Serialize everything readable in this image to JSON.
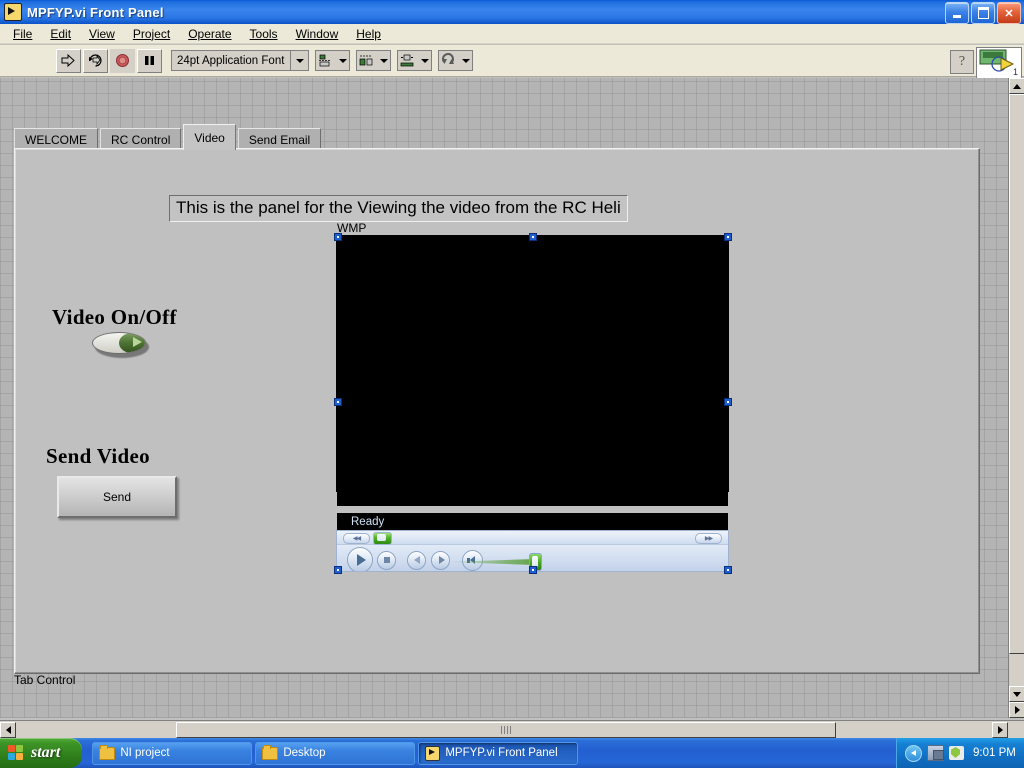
{
  "window": {
    "title": "MPFYP.vi Front Panel",
    "icon": "labview-vi-icon",
    "buttons": {
      "minimize": "minimize-button",
      "restore": "restore-button",
      "close": "close-button"
    }
  },
  "menubar": {
    "items": [
      {
        "label": "File",
        "mnemonic": "F"
      },
      {
        "label": "Edit",
        "mnemonic": "E"
      },
      {
        "label": "View",
        "mnemonic": "V"
      },
      {
        "label": "Project",
        "mnemonic": "P"
      },
      {
        "label": "Operate",
        "mnemonic": "O"
      },
      {
        "label": "Tools",
        "mnemonic": "T"
      },
      {
        "label": "Window",
        "mnemonic": "W"
      },
      {
        "label": "Help",
        "mnemonic": "H"
      }
    ]
  },
  "toolbar": {
    "run_button": "run-arrow-icon",
    "run_continuous_button": "run-continuously-icon",
    "abort_button": "abort-execution-icon",
    "pause_button": "pause-icon",
    "font_selector": "24pt Application Font",
    "align_objects_button": "align-objects-icon",
    "distribute_objects_button": "distribute-objects-icon",
    "resize_objects_button": "resize-objects-icon",
    "reorder_button": "reorder-icon",
    "help_button": "?",
    "vi_icon": "vi-icon-pane"
  },
  "panel": {
    "tabs": [
      {
        "label": "WELCOME",
        "active": false
      },
      {
        "label": "RC Control",
        "active": false
      },
      {
        "label": "Video",
        "active": true
      },
      {
        "label": "Send Email",
        "active": false
      }
    ],
    "heading": "This is the panel for the Viewing the video from the RC Heli",
    "controls": {
      "video_toggle_label": "Video On/Off",
      "video_toggle_state": "on",
      "send_video_label": "Send Video",
      "send_button_label": "Send"
    },
    "wmp": {
      "label": "WMP",
      "status": "Ready",
      "screen_color": "#000000",
      "transport": {
        "play": "play-button",
        "stop": "stop-button",
        "previous": "previous-button",
        "next": "next-button",
        "mute": "mute-button",
        "rewind": "rewind-pill",
        "fast_forward": "fast-forward-pill"
      },
      "volume_position_percent": 88,
      "seek_position_percent": 4
    },
    "status_label": "Tab Control"
  },
  "taskbar": {
    "start_label": "start",
    "items": [
      {
        "label": "NI project",
        "icon": "folder-icon",
        "active": false
      },
      {
        "label": "Desktop",
        "icon": "folder-icon",
        "active": false
      },
      {
        "label": "MPFYP.vi Front Panel",
        "icon": "labview-vi-icon",
        "active": true
      }
    ],
    "tray": {
      "icons": [
        "network-icon",
        "security-shield-icon"
      ],
      "clock": "9:01 PM"
    }
  },
  "colors": {
    "titlebar_blue": "#2a76e6",
    "panel_gray": "#c0c0c0",
    "canvas_gray": "#b4b4b4",
    "switch_green": "#4e7434",
    "taskbar_blue": "#2566d6",
    "start_green": "#3d9426"
  }
}
